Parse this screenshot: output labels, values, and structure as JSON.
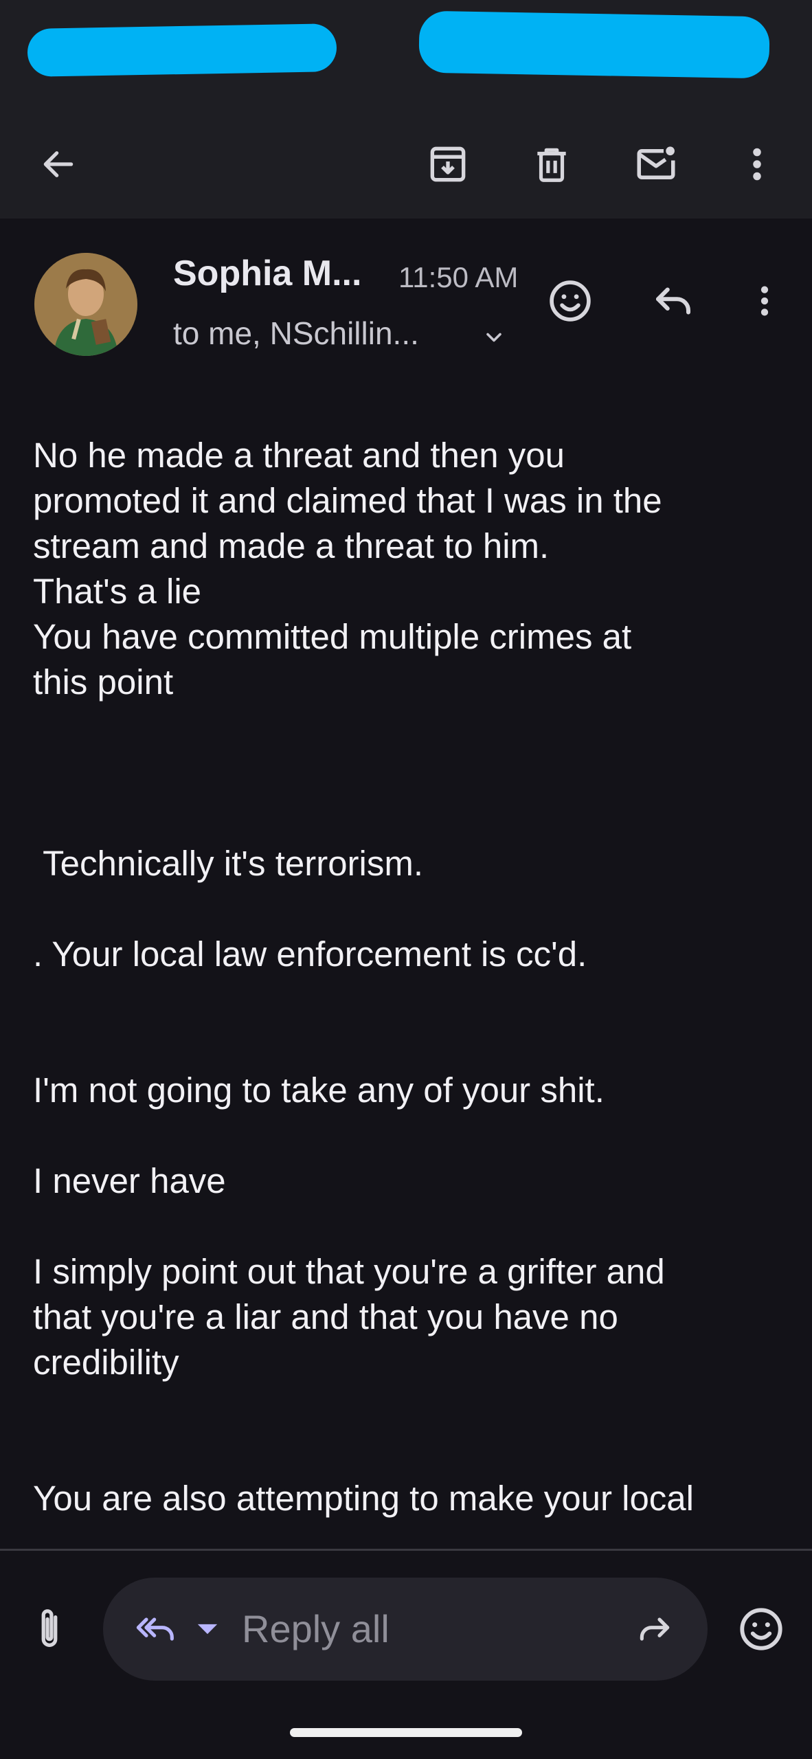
{
  "toolbar": {
    "back_icon": "arrow-left-icon",
    "archive_icon": "archive-icon",
    "delete_icon": "trash-icon",
    "mark_unread_icon": "mail-unread-icon",
    "more_icon": "more-vert-icon"
  },
  "email": {
    "sender": "Sophia M...",
    "time": "11:50 AM",
    "recipients": "to me, NSchillin...",
    "body": [
      "No he made a threat and then you\npromoted it and claimed that I was in the\nstream and made a threat to him.\nThat's a lie\nYou have committed multiple crimes at\nthis point",
      "",
      "",
      "",
      " Technically it's terrorism.",
      "",
      ". Your local law enforcement is cc'd.",
      "",
      "",
      "I'm not going to take any of your shit.",
      "",
      "I never have",
      "",
      "I simply point out that you're a grifter and\nthat you're a liar and that you have no\ncredibility",
      "",
      "",
      "You are also attempting to make your local"
    ]
  },
  "compose": {
    "reply_all_label": "Reply all"
  },
  "colors": {
    "background": "#131218",
    "redaction": "#00b2f4",
    "reply_icon_accent": "#b9b6ff"
  }
}
